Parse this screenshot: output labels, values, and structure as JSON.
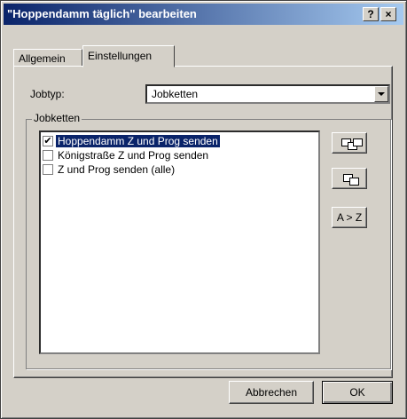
{
  "window": {
    "title": "\"Hoppendamm täglich\" bearbeiten",
    "help_label": "?",
    "close_label": "×"
  },
  "tabs": [
    {
      "label": "Allgemein",
      "active": false
    },
    {
      "label": "Einstellungen",
      "active": true
    }
  ],
  "form": {
    "jobtyp_label": "Jobtyp:",
    "jobtyp_value": "Jobketten"
  },
  "group": {
    "label": "Jobketten",
    "items": [
      {
        "label": "Hoppendamm Z und Prog senden",
        "checked": true,
        "selected": true
      },
      {
        "label": "Königstraße Z und Prog senden",
        "checked": false,
        "selected": false
      },
      {
        "label": "Z und Prog senden (alle)",
        "checked": false,
        "selected": false
      }
    ],
    "sort_label": "A > Z"
  },
  "buttons": {
    "cancel": "Abbrechen",
    "ok": "OK"
  }
}
